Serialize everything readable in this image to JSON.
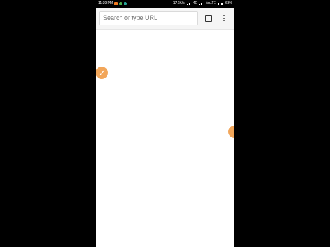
{
  "status_bar": {
    "time": "11:39 PM",
    "network_speed": "17.1K/s",
    "network_type": "4G",
    "volte": "VoLTE",
    "battery": "63%",
    "battery_level": 0.63,
    "notification_icons": [
      "orange-app-icon",
      "green-app-icon",
      "teal-app-icon"
    ]
  },
  "toolbar": {
    "search_placeholder": "Search or type URL",
    "tabs_icon": "tab-switcher-icon",
    "menu_icon": "overflow-menu-icon"
  },
  "overlays": {
    "left_bubble_icon": "brush-icon",
    "right_bubble_icon": "floating-bubble-icon"
  },
  "colors": {
    "accent_orange": "#f2a65a",
    "toolbar_bg": "#f5f5f5",
    "page_bg": "#ffffff",
    "background": "#000000"
  }
}
